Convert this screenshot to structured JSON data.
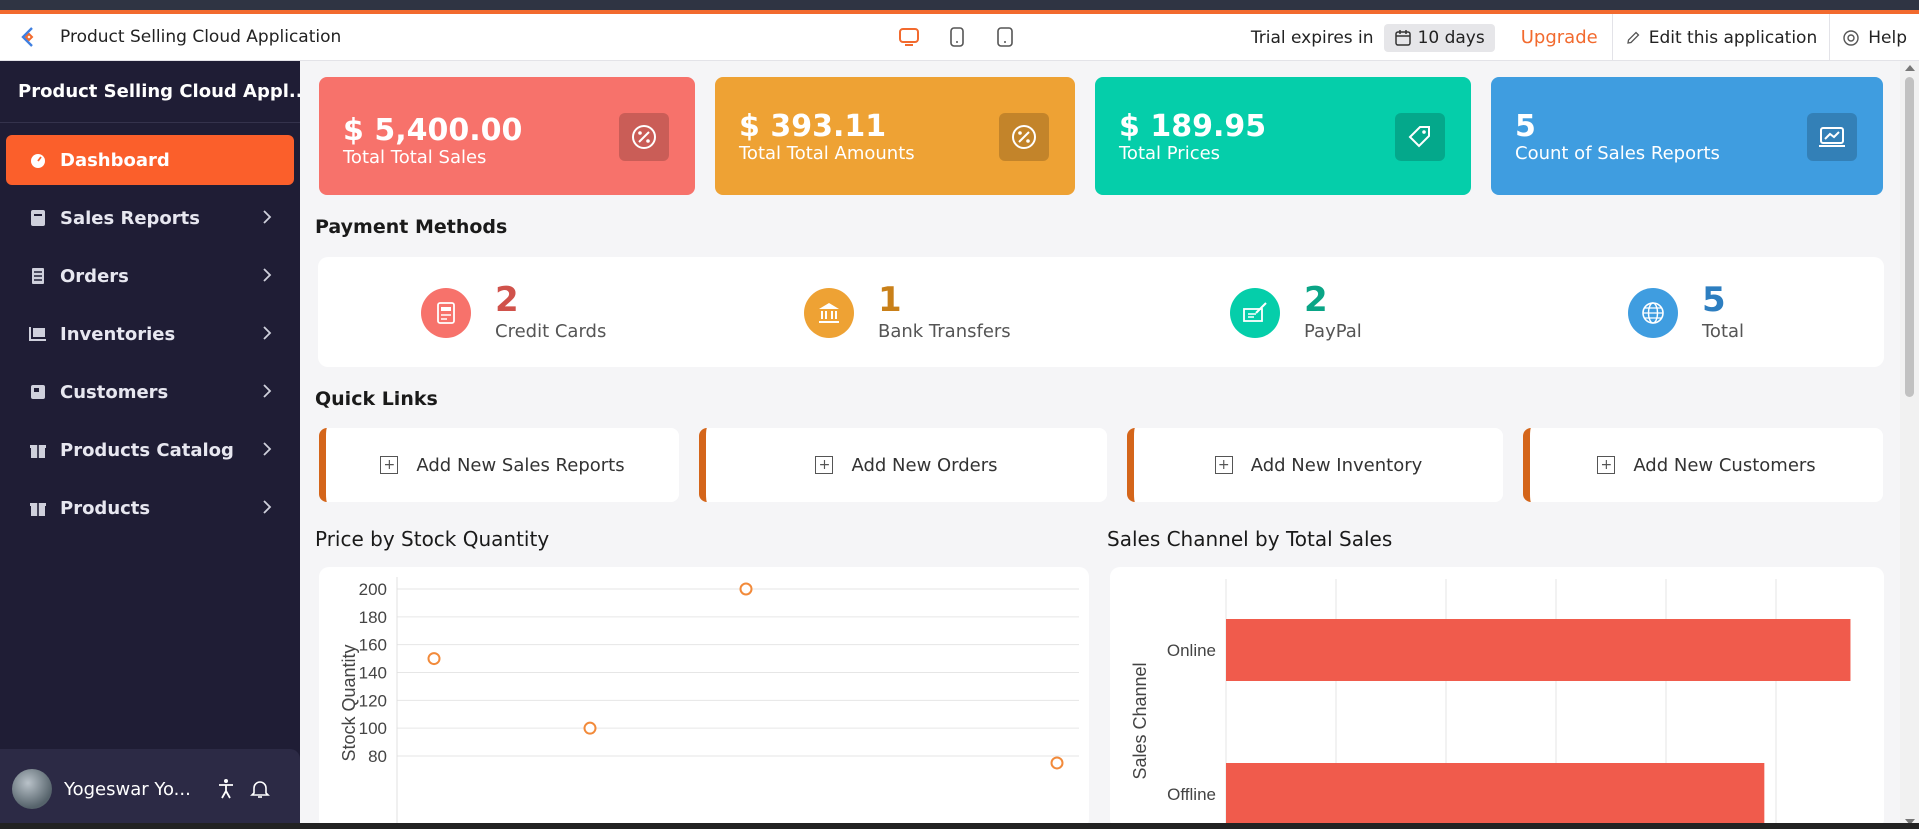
{
  "appbar": {
    "title": "Product Selling Cloud Application",
    "trial_label": "Trial expires in",
    "trial_days": "10 days",
    "upgrade": "Upgrade",
    "edit": "Edit this application",
    "help": "Help",
    "device_icons": [
      "desktop-icon",
      "tablet-icon",
      "mobile-icon"
    ]
  },
  "sidebar": {
    "app_name": "Product Selling Cloud Appl...",
    "items": [
      {
        "label": "Dashboard",
        "icon": "dashboard-icon",
        "active": true
      },
      {
        "label": "Sales Reports",
        "icon": "report-icon"
      },
      {
        "label": "Orders",
        "icon": "orders-icon"
      },
      {
        "label": "Inventories",
        "icon": "inventory-icon"
      },
      {
        "label": "Customers",
        "icon": "customers-icon"
      },
      {
        "label": "Products Catalog",
        "icon": "gift-icon"
      },
      {
        "label": "Products",
        "icon": "gift-icon"
      }
    ],
    "user": "Yogeswar Yo..."
  },
  "stats": [
    {
      "value": "$ 5,400.00",
      "label": "Total Total Sales",
      "color": "#f7726b",
      "icon": "percent-icon"
    },
    {
      "value": "$ 393.11",
      "label": "Total Total Amounts",
      "color": "#eea234",
      "icon": "percent-icon"
    },
    {
      "value": "$ 189.95",
      "label": "Total Prices",
      "color": "#05ceaa",
      "icon": "tag-icon"
    },
    {
      "value": "5",
      "label": "Count of Sales Reports",
      "color": "#3f9de0",
      "icon": "chart-screen-icon"
    }
  ],
  "payment": {
    "title": "Payment Methods",
    "items": [
      {
        "num": "2",
        "label": "Credit Cards",
        "color": "#f7726b",
        "numcolor": "#d0524b",
        "icon": "credit-card-icon"
      },
      {
        "num": "1",
        "label": "Bank Transfers",
        "color": "#eea234",
        "numcolor": "#c98019",
        "icon": "bank-icon"
      },
      {
        "num": "2",
        "label": "PayPal",
        "color": "#05ceaa",
        "numcolor": "#0aa586",
        "icon": "cheque-icon"
      },
      {
        "num": "5",
        "label": "Total",
        "color": "#3f9de0",
        "numcolor": "#2d7ec0",
        "icon": "globe-icon"
      }
    ]
  },
  "quick_links": {
    "title": "Quick Links",
    "items": [
      "Add New Sales Reports",
      "Add New Orders",
      "Add New Inventory",
      "Add New Customers"
    ]
  },
  "chart_data": [
    {
      "type": "scatter",
      "title": "Price by Stock Quantity",
      "ylabel": "Stock Quantity",
      "xlabel": "",
      "ylim": [
        70,
        210
      ],
      "yticks": [
        200,
        180,
        160,
        140,
        120,
        100,
        80
      ],
      "points": [
        {
          "x": 1,
          "y": 150
        },
        {
          "x": 2,
          "y": 100
        },
        {
          "x": 3,
          "y": 200
        },
        {
          "x": 4,
          "y": 75
        }
      ],
      "color": "#f28a3a"
    },
    {
      "type": "bar",
      "orientation": "horizontal",
      "title": "Sales Channel by Total Sales",
      "ylabel": "Sales Channel",
      "categories": [
        "Online",
        "Offline"
      ],
      "values": [
        2900,
        2500
      ],
      "xlim": [
        0,
        3000
      ],
      "color": "#f05b4c"
    }
  ]
}
